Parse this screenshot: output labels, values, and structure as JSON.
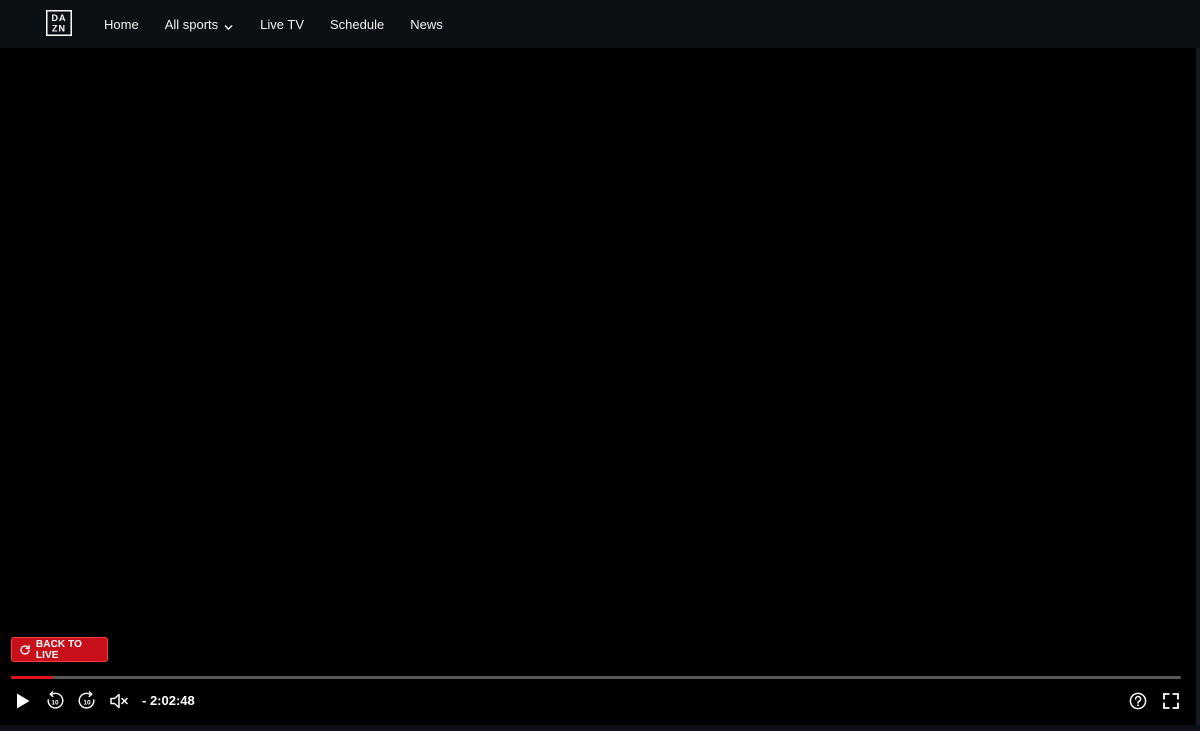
{
  "nav": {
    "logo_text": "DAZN",
    "items": [
      {
        "label": "Home"
      },
      {
        "label": "All sports"
      },
      {
        "label": "Live TV"
      },
      {
        "label": "Schedule"
      },
      {
        "label": "News"
      }
    ]
  },
  "player": {
    "back_to_live_label": "BACK TO LIVE",
    "remaining_time": "- 2:02:48",
    "progress_fraction": 0.036,
    "accent_color": "#e3141e",
    "icons": {
      "play": "play-icon",
      "rewind": "rewind-10-icon",
      "forward": "forward-10-icon",
      "mute": "muted-speaker-icon",
      "help": "help-icon",
      "fullscreen": "fullscreen-icon",
      "back_to_live": "refresh-icon"
    },
    "skip_seconds": "10"
  }
}
